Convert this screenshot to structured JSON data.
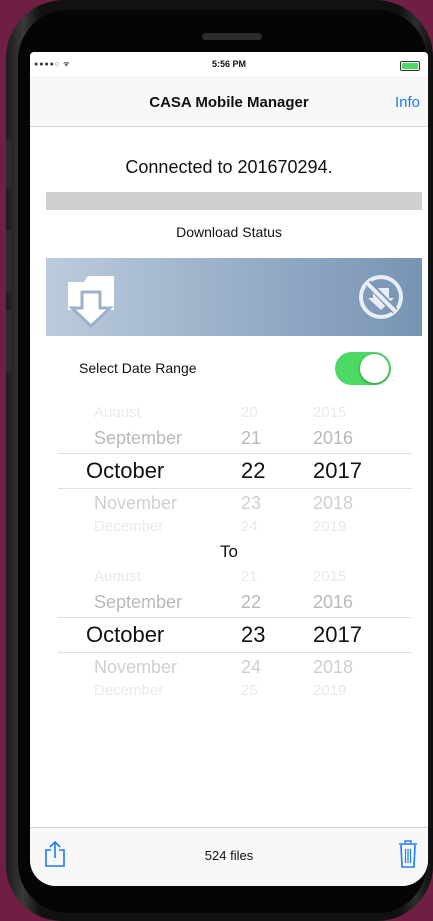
{
  "status_bar": {
    "carrier": "●●●●○ ᯤ",
    "time": "5:56 PM"
  },
  "nav": {
    "title": "CASA Mobile Manager",
    "info_label": "Info"
  },
  "connection": {
    "text": "Connected to 201670294."
  },
  "download": {
    "status_label": "Download Status",
    "progress": 0
  },
  "date_range": {
    "label": "Select Date Range",
    "enabled": true
  },
  "from_picker": {
    "rows": [
      {
        "month": "August",
        "day": "20",
        "year": "2015"
      },
      {
        "month": "September",
        "day": "21",
        "year": "2016"
      },
      {
        "month": "October",
        "day": "22",
        "year": "2017"
      },
      {
        "month": "November",
        "day": "23",
        "year": "2018"
      },
      {
        "month": "December",
        "day": "24",
        "year": "2019"
      }
    ]
  },
  "to_label": "To",
  "to_picker": {
    "rows": [
      {
        "month": "August",
        "day": "21",
        "year": "2015"
      },
      {
        "month": "September",
        "day": "22",
        "year": "2016"
      },
      {
        "month": "October",
        "day": "23",
        "year": "2017"
      },
      {
        "month": "November",
        "day": "24",
        "year": "2018"
      },
      {
        "month": "December",
        "day": "25",
        "year": "2019"
      }
    ]
  },
  "toolbar": {
    "file_count": "524 files"
  },
  "icons": {
    "share": "share-icon",
    "trash": "trash-icon",
    "folder_download": "folder-download-icon",
    "no_download": "no-download-icon"
  },
  "colors": {
    "accent": "#1a7cf5",
    "toggle_on": "#4cd964",
    "background": "#6e1f43",
    "banner_start": "#bccbdc",
    "banner_end": "#7894b4"
  }
}
